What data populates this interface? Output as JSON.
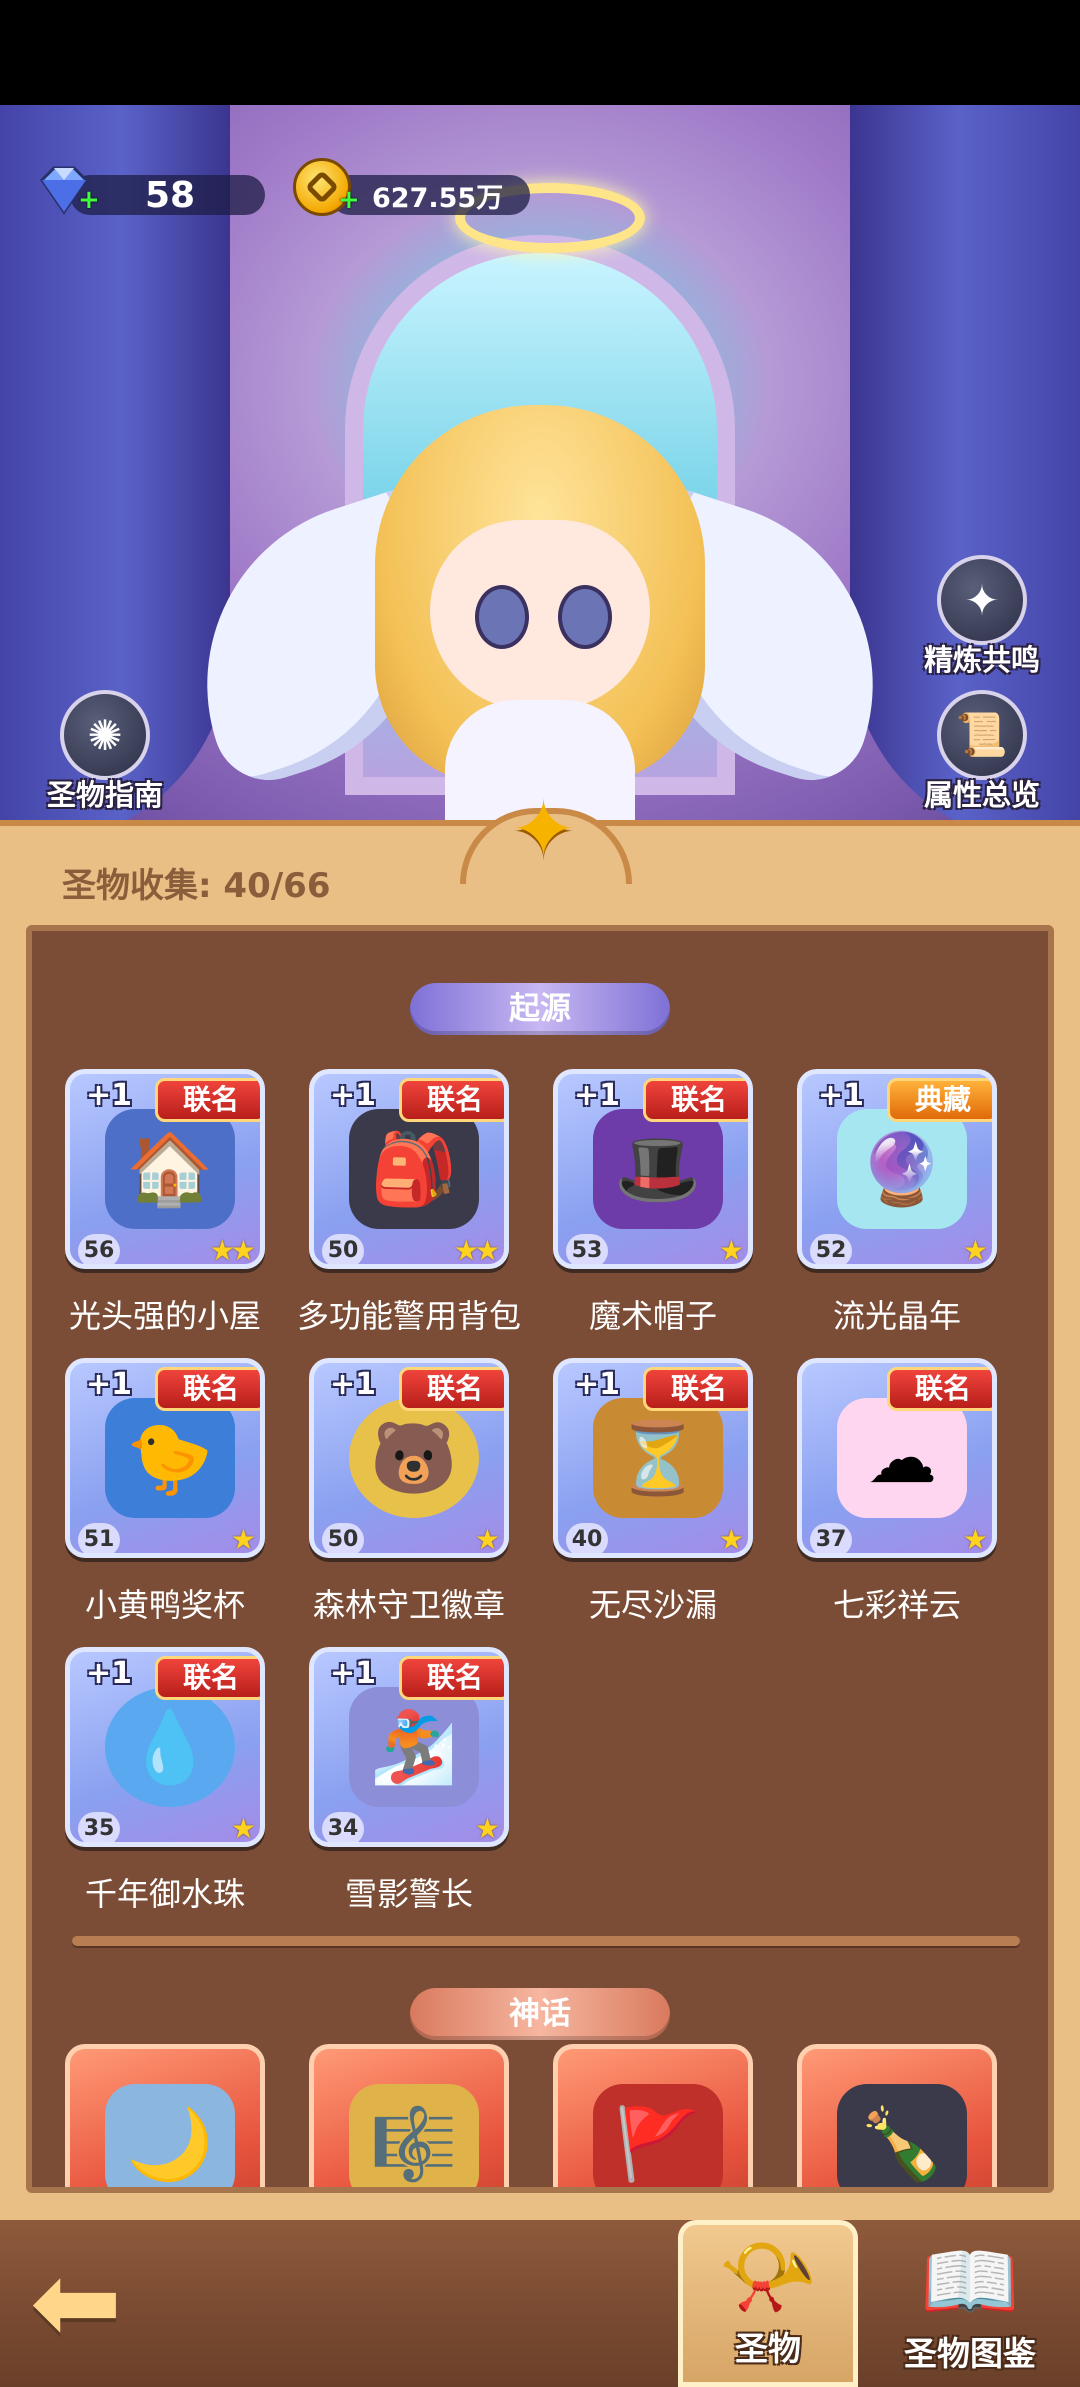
{
  "resources": {
    "gems": "58",
    "coins": "627.55万"
  },
  "side_buttons": {
    "guide": "圣物指南",
    "refine": "精炼共鸣",
    "attributes": "属性总览"
  },
  "collection": {
    "title": "圣物收集: 40/66"
  },
  "sections": [
    {
      "label": "起源",
      "items": [
        {
          "name": "光头强的小屋",
          "bonus": "+1",
          "tag": "联名",
          "level": "56",
          "stars": 2,
          "icon": "house-icon"
        },
        {
          "name": "多功能警用背包",
          "bonus": "+1",
          "tag": "联名",
          "level": "50",
          "stars": 2,
          "icon": "backpack-icon"
        },
        {
          "name": "魔术帽子",
          "bonus": "+1",
          "tag": "联名",
          "level": "53",
          "stars": 1,
          "icon": "magic-hat-icon"
        },
        {
          "name": "流光晶年",
          "bonus": "+1",
          "tag": "典藏",
          "level": "52",
          "stars": 1,
          "icon": "crystal-ball-icon"
        },
        {
          "name": "小黄鸭奖杯",
          "bonus": "+1",
          "tag": "联名",
          "level": "51",
          "stars": 1,
          "icon": "duck-trophy-icon"
        },
        {
          "name": "森林守卫徽章",
          "bonus": "+1",
          "tag": "联名",
          "level": "50",
          "stars": 1,
          "icon": "bear-badge-icon"
        },
        {
          "name": "无尽沙漏",
          "bonus": "+1",
          "tag": "联名",
          "level": "40",
          "stars": 1,
          "icon": "hourglass-icon"
        },
        {
          "name": "七彩祥云",
          "bonus": "",
          "tag": "联名",
          "level": "37",
          "stars": 1,
          "icon": "cloud-icon"
        },
        {
          "name": "千年御水珠",
          "bonus": "+1",
          "tag": "联名",
          "level": "35",
          "stars": 1,
          "icon": "water-orb-icon"
        },
        {
          "name": "雪影警长",
          "bonus": "+1",
          "tag": "联名",
          "level": "34",
          "stars": 1,
          "icon": "snowboard-cat-icon"
        }
      ]
    },
    {
      "label": "神话",
      "items": [
        {
          "icon": "moon-mirror-icon"
        },
        {
          "icon": "harp-icon"
        },
        {
          "icon": "banner-icon"
        },
        {
          "icon": "potion-bottle-icon"
        }
      ]
    }
  ],
  "bottom_tabs": {
    "relics": "圣物",
    "relic_atlas": "圣物图鉴"
  },
  "colors": {
    "panel_bg": "#e9bf86",
    "inner_bg": "#7b4d37",
    "origin_pill": "#9b8ee0",
    "myth_pill": "#e7937a",
    "tag_red": "#d8322b"
  }
}
